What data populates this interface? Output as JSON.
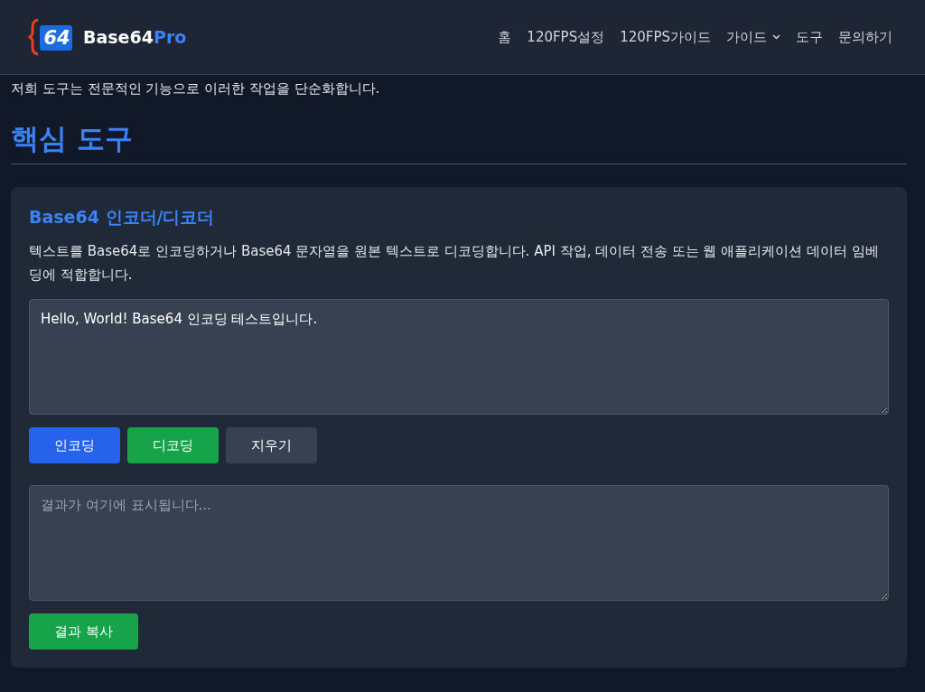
{
  "header": {
    "logo_badge": "64",
    "logo_text": "Base64",
    "logo_accent": "Pro",
    "nav": [
      {
        "label": "홈",
        "dropdown": false
      },
      {
        "label": "120FPS설정",
        "dropdown": false
      },
      {
        "label": "120FPS가이드",
        "dropdown": false
      },
      {
        "label": "가이드",
        "dropdown": true
      },
      {
        "label": "도구",
        "dropdown": false
      },
      {
        "label": "문의하기",
        "dropdown": false
      }
    ]
  },
  "intro": "저희 도구는 전문적인 기능으로 이러한 작업을 단순화합니다.",
  "section_title": "핵심 도구",
  "tool": {
    "title": "Base64 인코더/디코더",
    "description": "텍스트를 Base64로 인코딩하거나 Base64 문자열을 원본 텍스트로 디코딩합니다. API 작업, 데이터 전송 또는 웹 애플리케이션 데이터 임베딩에 적합합니다.",
    "input": {
      "value": "Hello, World! Base64 인코딩 테스트입니다."
    },
    "buttons": [
      {
        "label": "인코딩",
        "kind": "primary"
      },
      {
        "label": "디코딩",
        "kind": "success"
      },
      {
        "label": "지우기",
        "kind": "secondary"
      }
    ],
    "output": {
      "placeholder": "결과가 여기에 표시됩니다..."
    },
    "copy_button": {
      "label": "결과 복사",
      "kind": "success"
    }
  }
}
